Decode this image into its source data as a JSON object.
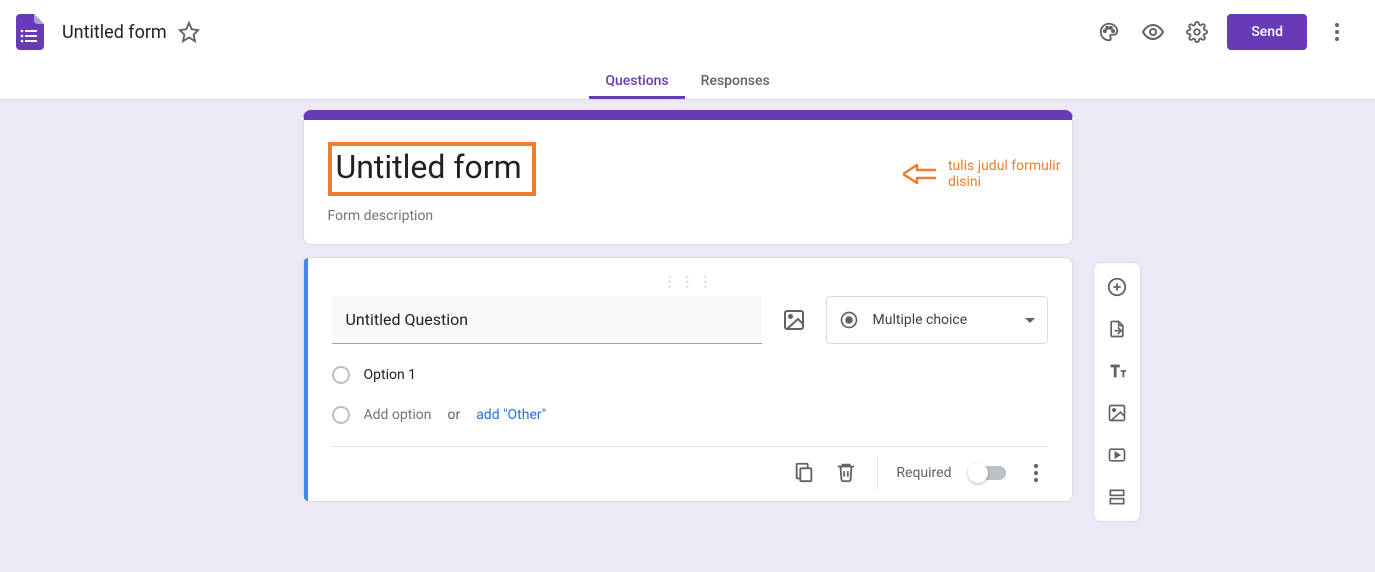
{
  "header": {
    "doc_title": "Untitled form",
    "send_label": "Send"
  },
  "tabs": {
    "questions": "Questions",
    "responses": "Responses"
  },
  "form": {
    "title": "Untitled form",
    "description_placeholder": "Form description"
  },
  "annotation": {
    "text": "tulis judul formulir disini"
  },
  "question": {
    "title": "Untitled Question",
    "type_label": "Multiple choice",
    "option1": "Option 1",
    "add_option": "Add option",
    "or": "or",
    "add_other": "add \"Other\"",
    "required_label": "Required"
  }
}
